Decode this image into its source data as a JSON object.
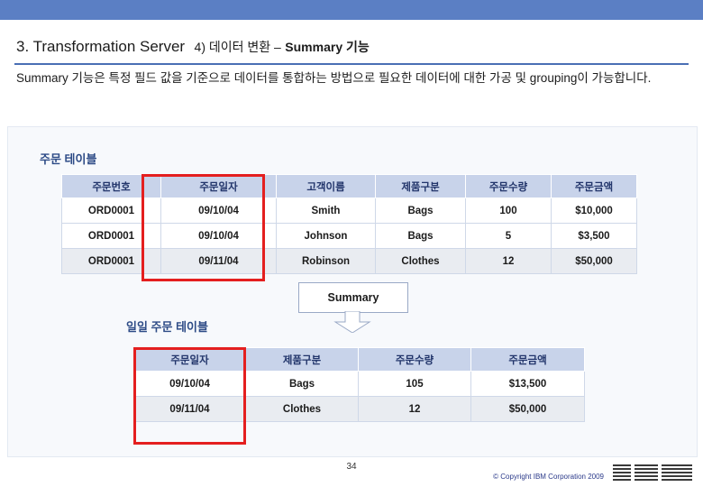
{
  "slide": {
    "title_main": "3. Transformation Server",
    "title_sub": "4) 데이터 변환 –",
    "title_sub_bold": "Summary 기능",
    "lead_text": "Summary 기능은 특정 필드 값을 기준으로 데이터를 통합하는 방법으로 필요한 데이터에 대한 가공 및 grouping이 가능합니다.",
    "page_number": "34",
    "copyright": "© Copyright IBM Corporation 2009",
    "logo_text": "IBM",
    "accent_color": "#5b7fc4",
    "header_fill": "#c8d3ea",
    "highlight_color": "#e41f1f"
  },
  "orders_section": {
    "label": "주문 테이블",
    "columns": [
      "주문번호",
      "주문일자",
      "고객이름",
      "제품구분",
      "주문수량",
      "주문금액"
    ],
    "rows": [
      [
        "ORD0001",
        "09/10/04",
        "Smith",
        "Bags",
        "100",
        "$10,000"
      ],
      [
        "ORD0001",
        "09/10/04",
        "Johnson",
        "Bags",
        "5",
        "$3,500"
      ],
      [
        "ORD0001",
        "09/11/04",
        "Robinson",
        "Clothes",
        "12",
        "$50,000"
      ]
    ]
  },
  "connector": {
    "label": "Summary",
    "arrow": "down-arrow-icon"
  },
  "summary_section": {
    "label": "일일 주문 테이블",
    "columns": [
      "주문일자",
      "제품구분",
      "주문수량",
      "주문금액"
    ],
    "rows": [
      [
        "09/10/04",
        "Bags",
        "105",
        "$13,500"
      ],
      [
        "09/11/04",
        "Clothes",
        "12",
        "$50,000"
      ]
    ]
  }
}
